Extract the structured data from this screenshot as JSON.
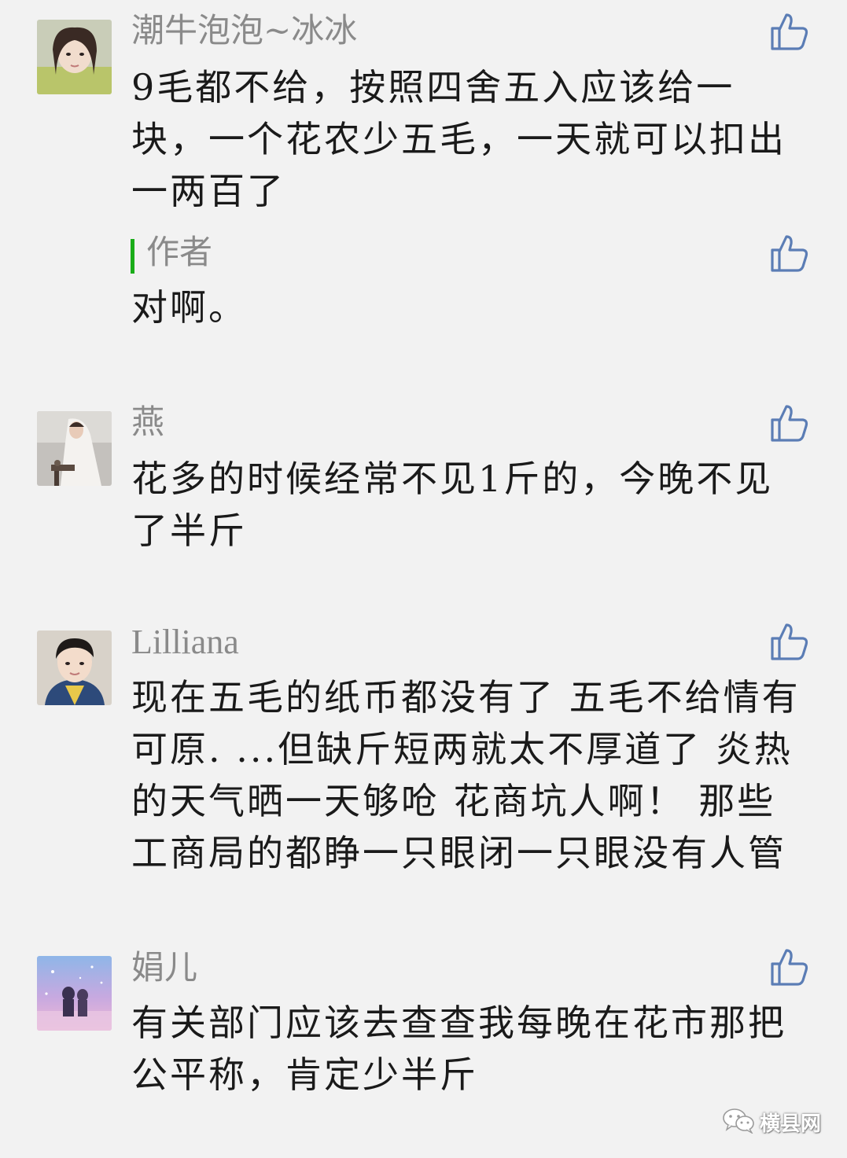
{
  "comments": [
    {
      "nickname": "潮牛泡泡~冰冰",
      "text": "9毛都不给，按照四舍五入应该给一块，一个花农少五毛，一天就可以扣出一两百了",
      "reply": {
        "label": "作者",
        "text": "对啊。"
      }
    },
    {
      "nickname": "燕",
      "text": "花多的时候经常不见1斤的，今晚不见了半斤"
    },
    {
      "nickname": "Lilliana",
      "text": "现在五毛的纸币都没有了 五毛不给情有可原. ...但缺斤短两就太不厚道了 炎热的天气晒一天够呛 花商坑人啊！ 那些工商局的都睁一只眼闭一只眼没有人管"
    },
    {
      "nickname": "娟儿",
      "text": "有关部门应该去查查我每晚在花市那把公平称，肯定少半斤"
    }
  ],
  "icons": {
    "like": "thumbs-up-icon",
    "watermark": "wechat-icon"
  },
  "colors": {
    "background": "#f2f2f2",
    "nickname": "#8a8a8a",
    "text": "#1a1a1a",
    "author_accent": "#1aad19",
    "like_icon": "#5b7db5"
  },
  "watermark": {
    "text": "横县网"
  }
}
